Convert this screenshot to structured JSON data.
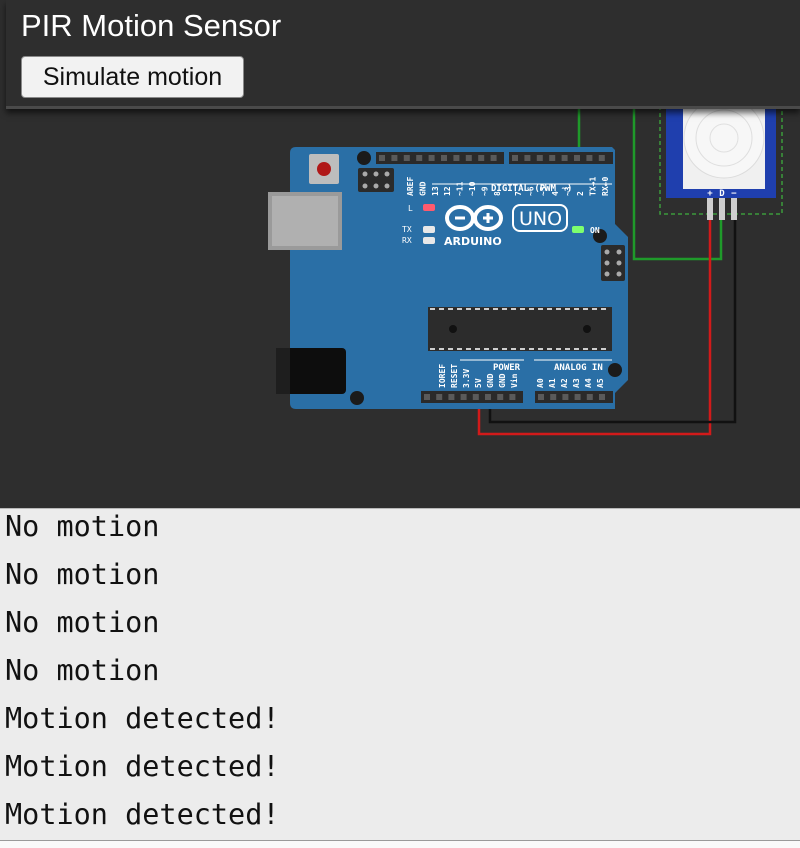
{
  "header": {
    "title": "PIR Motion Sensor",
    "simulate_button": "Simulate motion"
  },
  "board": {
    "name": "UNO",
    "brand": "ARDUINO",
    "digital_header_label": "DIGITAL (PWM ~)",
    "power_header_label": "POWER",
    "analog_header_label": "ANALOG IN",
    "on_label": "ON",
    "led_l_label": "L",
    "tx_label": "TX",
    "rx_label": "RX",
    "top_pin_labels": [
      "AREF",
      "GND",
      "13",
      "12",
      "~11",
      "~10",
      "~9",
      "8",
      "7",
      "~6",
      "~5",
      "4",
      "~3",
      "2",
      "TX→1",
      "RX←0"
    ],
    "power_pin_labels": [
      "IOREF",
      "RESET",
      "3.3V",
      "5V",
      "GND",
      "GND",
      "Vin"
    ],
    "analog_pin_labels": [
      "A0",
      "A1",
      "A2",
      "A3",
      "A4",
      "A5"
    ],
    "led_l_color": "#ff5a6e",
    "led_on_color": "#7dff6e",
    "board_color": "#2a6fa6"
  },
  "sensor": {
    "pin_labels": [
      "+",
      "D",
      "−"
    ]
  },
  "wires": {
    "signal_color": "#1f9a2a",
    "power_color": "#d21a1a",
    "ground_color": "#111111"
  },
  "serial_monitor": {
    "lines": [
      "No motion",
      "No motion",
      "No motion",
      "No motion",
      "Motion detected!",
      "Motion detected!",
      "Motion detected!"
    ]
  }
}
